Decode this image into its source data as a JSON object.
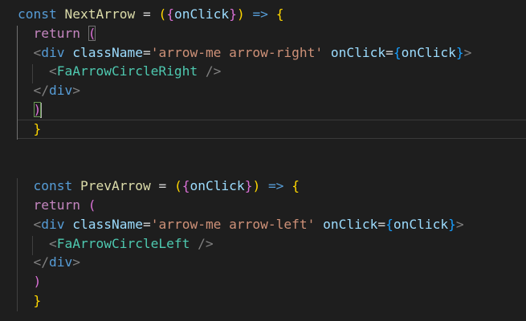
{
  "editor": {
    "language": "javascriptreact",
    "theme": "dark",
    "cursor": {
      "line": 6,
      "column": 5
    },
    "colors": {
      "background": "#1e1e1e",
      "keyword": "#569cd6",
      "control": "#c586c0",
      "function": "#dcdcaa",
      "variable": "#9cdcfe",
      "string": "#ce9178",
      "component": "#4ec9b0",
      "bracket_level_1": "#ffd700",
      "bracket_level_2": "#da70d6",
      "bracket_level_3": "#179fff"
    },
    "lines": [
      [
        {
          "t": "const",
          "c": "kw"
        },
        {
          "t": " "
        },
        {
          "t": "NextArrow",
          "c": "fn"
        },
        {
          "t": " "
        },
        {
          "t": "=",
          "c": "op"
        },
        {
          "t": " "
        },
        {
          "t": "(",
          "c": "b1"
        },
        {
          "t": "{",
          "c": "b2"
        },
        {
          "t": "onClick",
          "c": "var"
        },
        {
          "t": "}",
          "c": "b2"
        },
        {
          "t": ")",
          "c": "b1"
        },
        {
          "t": " "
        },
        {
          "t": "=>",
          "c": "arrow"
        },
        {
          "t": " "
        },
        {
          "t": "{",
          "c": "b1"
        }
      ],
      [
        {
          "t": "  "
        },
        {
          "t": "return",
          "c": "ctl"
        },
        {
          "t": " "
        },
        {
          "t": "(",
          "c": "b2",
          "x": "bracket-box"
        }
      ],
      [
        {
          "t": "  "
        },
        {
          "t": "<",
          "c": "pun"
        },
        {
          "t": "div",
          "c": "tag"
        },
        {
          "t": " "
        },
        {
          "t": "className",
          "c": "attr"
        },
        {
          "t": "=",
          "c": "op"
        },
        {
          "t": "'arrow-me arrow-right'",
          "c": "str"
        },
        {
          "t": " "
        },
        {
          "t": "onClick",
          "c": "attr"
        },
        {
          "t": "=",
          "c": "op"
        },
        {
          "t": "{",
          "c": "b3"
        },
        {
          "t": "onClick",
          "c": "var"
        },
        {
          "t": "}",
          "c": "b3"
        },
        {
          "t": ">",
          "c": "pun"
        }
      ],
      [
        {
          "t": "    "
        },
        {
          "t": "<",
          "c": "pun"
        },
        {
          "t": "FaArrowCircleRight",
          "c": "cmp"
        },
        {
          "t": " "
        },
        {
          "t": "/>",
          "c": "pun"
        }
      ],
      [
        {
          "t": "  "
        },
        {
          "t": "</",
          "c": "pun"
        },
        {
          "t": "div",
          "c": "tag"
        },
        {
          "t": ">",
          "c": "pun"
        }
      ],
      [
        {
          "t": "  "
        },
        {
          "t": ")",
          "c": "b2",
          "x": "bracket-match"
        },
        {
          "cursor": true
        }
      ],
      [
        {
          "t": "  "
        },
        {
          "t": "}",
          "c": "b1"
        }
      ],
      [],
      [],
      [
        {
          "t": "  "
        },
        {
          "t": "const",
          "c": "kw"
        },
        {
          "t": " "
        },
        {
          "t": "PrevArrow",
          "c": "fn"
        },
        {
          "t": " "
        },
        {
          "t": "=",
          "c": "op"
        },
        {
          "t": " "
        },
        {
          "t": "(",
          "c": "b1"
        },
        {
          "t": "{",
          "c": "b2"
        },
        {
          "t": "onClick",
          "c": "var"
        },
        {
          "t": "}",
          "c": "b2"
        },
        {
          "t": ")",
          "c": "b1"
        },
        {
          "t": " "
        },
        {
          "t": "=>",
          "c": "arrow"
        },
        {
          "t": " "
        },
        {
          "t": "{",
          "c": "b1"
        }
      ],
      [
        {
          "t": "  "
        },
        {
          "t": "return",
          "c": "ctl"
        },
        {
          "t": " "
        },
        {
          "t": "(",
          "c": "b2"
        }
      ],
      [
        {
          "t": "  "
        },
        {
          "t": "<",
          "c": "pun"
        },
        {
          "t": "div",
          "c": "tag"
        },
        {
          "t": " "
        },
        {
          "t": "className",
          "c": "attr"
        },
        {
          "t": "=",
          "c": "op"
        },
        {
          "t": "'arrow-me arrow-left'",
          "c": "str"
        },
        {
          "t": " "
        },
        {
          "t": "onClick",
          "c": "attr"
        },
        {
          "t": "=",
          "c": "op"
        },
        {
          "t": "{",
          "c": "b3"
        },
        {
          "t": "onClick",
          "c": "var"
        },
        {
          "t": "}",
          "c": "b3"
        },
        {
          "t": ">",
          "c": "pun"
        }
      ],
      [
        {
          "t": "    "
        },
        {
          "t": "<",
          "c": "pun"
        },
        {
          "t": "FaArrowCircleLeft",
          "c": "cmp"
        },
        {
          "t": " "
        },
        {
          "t": "/>",
          "c": "pun"
        }
      ],
      [
        {
          "t": "  "
        },
        {
          "t": "</",
          "c": "pun"
        },
        {
          "t": "div",
          "c": "tag"
        },
        {
          "t": ">",
          "c": "pun"
        }
      ],
      [
        {
          "t": "  "
        },
        {
          "t": ")",
          "c": "b2"
        }
      ],
      [
        {
          "t": "  "
        },
        {
          "t": "}",
          "c": "b1"
        }
      ]
    ]
  }
}
